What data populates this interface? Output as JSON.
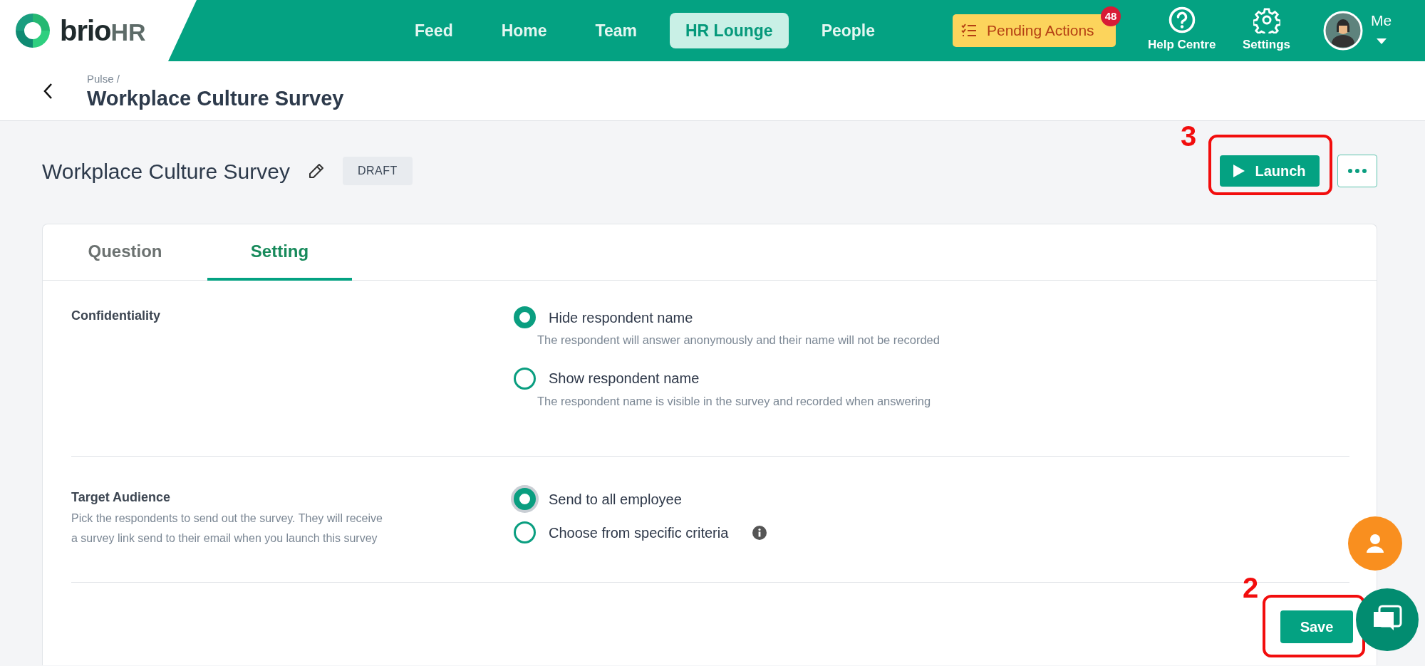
{
  "header": {
    "logo": {
      "word": "brio",
      "suffix": "HR"
    },
    "nav": [
      {
        "label": "Feed",
        "selected": false
      },
      {
        "label": "Home",
        "selected": false
      },
      {
        "label": "Team",
        "selected": false
      },
      {
        "label": "HR Lounge",
        "selected": true
      },
      {
        "label": "People",
        "selected": false
      }
    ],
    "pending_actions": {
      "label": "Pending Actions",
      "count": "48"
    },
    "help": {
      "label": "Help Centre"
    },
    "settings": {
      "label": "Settings"
    },
    "user": {
      "label": "Me"
    }
  },
  "breadcrumb": {
    "items": [
      "Pulse"
    ],
    "separator": "/",
    "title": "Workplace Culture Survey"
  },
  "survey": {
    "title": "Workplace Culture Survey",
    "status": "DRAFT",
    "launch": "Launch"
  },
  "tabs": [
    {
      "label": "Question",
      "selected": false
    },
    {
      "label": "Setting",
      "selected": true
    }
  ],
  "sections": [
    {
      "title": "Confidentiality",
      "options": [
        {
          "label": "Hide respondent name",
          "description": "The respondent will answer anonymously and their name will not be recorded",
          "selected": true,
          "focused": false,
          "info": false
        },
        {
          "label": "Show respondent name",
          "description": "The respondent name is visible in the survey and recorded when answering",
          "selected": false,
          "focused": false,
          "info": false
        }
      ]
    },
    {
      "title": "Target Audience",
      "description": "Pick the respondents to send out the survey. They will receive a survey link send to their email when you launch this survey",
      "options": [
        {
          "label": "Send to all employee",
          "selected": true,
          "focused": true,
          "info": false
        },
        {
          "label": "Choose from specific criteria",
          "selected": false,
          "focused": false,
          "info": true
        }
      ]
    }
  ],
  "save": "Save",
  "annotations": [
    {
      "label": "3"
    },
    {
      "label": "2"
    }
  ]
}
